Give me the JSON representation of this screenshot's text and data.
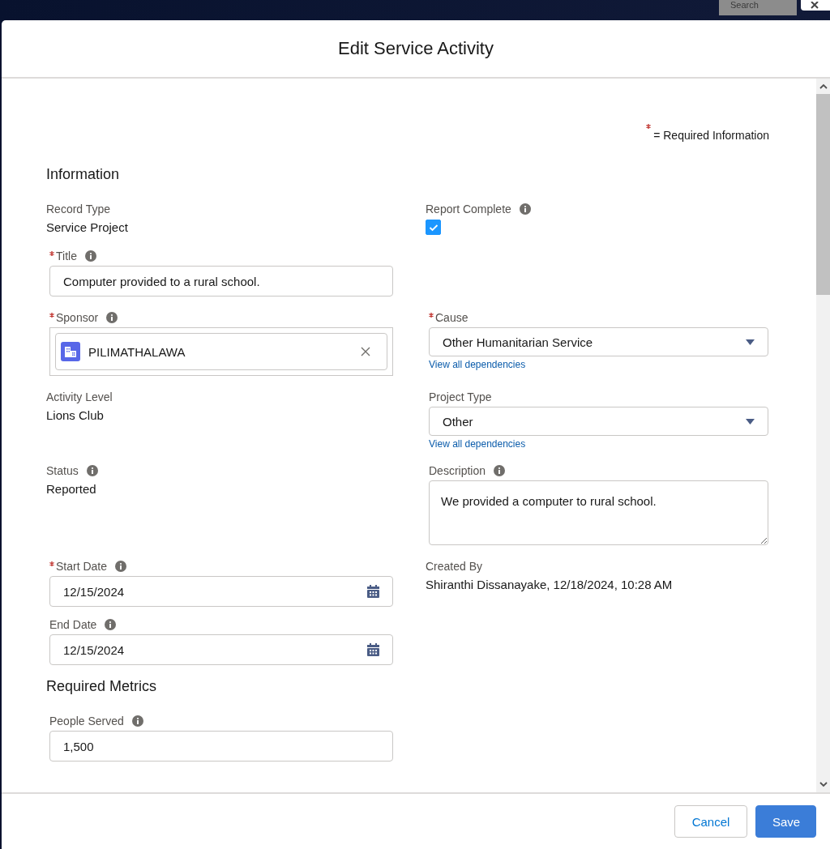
{
  "background": {
    "search_placeholder": "Search"
  },
  "modal": {
    "title": "Edit Service Activity"
  },
  "required_legend": {
    "text": "= Required Information"
  },
  "sections": [
    {
      "title": "Information",
      "rows": [
        {
          "left": [
            {
              "kind": "readonly",
              "label": "Record Type",
              "required": false,
              "info": false,
              "value": "Service Project"
            }
          ],
          "right": [
            {
              "kind": "checkbox",
              "label": "Report Complete",
              "required": false,
              "info": true,
              "checked": true
            }
          ]
        },
        {
          "left": [
            {
              "kind": "text",
              "label": "Title",
              "required": true,
              "info": true,
              "value": "Computer provided to a rural school."
            }
          ]
        },
        {
          "left": [
            {
              "kind": "lookup",
              "label": "Sponsor",
              "required": true,
              "info": true,
              "value": "PILIMATHALAWA"
            }
          ],
          "right": [
            {
              "kind": "picklist",
              "label": "Cause",
              "required": true,
              "info": false,
              "value": "Other Humanitarian Service",
              "link": "View all dependencies"
            }
          ]
        },
        {
          "left": [
            {
              "kind": "readonly",
              "label": "Activity Level",
              "required": false,
              "info": false,
              "value": "Lions Club"
            }
          ],
          "right": [
            {
              "kind": "picklist",
              "label": "Project Type",
              "required": false,
              "info": false,
              "value": "Other",
              "link": "View all dependencies"
            }
          ]
        },
        {
          "left": [
            {
              "kind": "readonly",
              "label": "Status",
              "required": false,
              "info": true,
              "value": "Reported"
            }
          ],
          "right": [
            {
              "kind": "textarea",
              "label": "Description",
              "required": false,
              "info": true,
              "value": "We provided a computer to rural school."
            }
          ]
        },
        {
          "left": [
            {
              "kind": "date",
              "label": "Start Date",
              "required": true,
              "info": true,
              "value": "12/15/2024"
            },
            {
              "kind": "date",
              "label": "End Date",
              "required": false,
              "info": true,
              "value": "12/15/2024"
            }
          ],
          "right": [
            {
              "kind": "readonly",
              "label": "Created By",
              "required": false,
              "info": false,
              "value": "Shiranthi Dissanayake, 12/18/2024, 10:28 AM"
            }
          ]
        }
      ]
    },
    {
      "title": "Required Metrics",
      "rows": [
        {
          "left": [
            {
              "kind": "text",
              "label": "People Served",
              "required": false,
              "info": true,
              "value": "1,500"
            }
          ]
        }
      ]
    }
  ],
  "footer": {
    "buttons": [
      {
        "label": "Cancel",
        "kind": "neutral"
      },
      {
        "label": "Save",
        "kind": "brand"
      }
    ]
  }
}
